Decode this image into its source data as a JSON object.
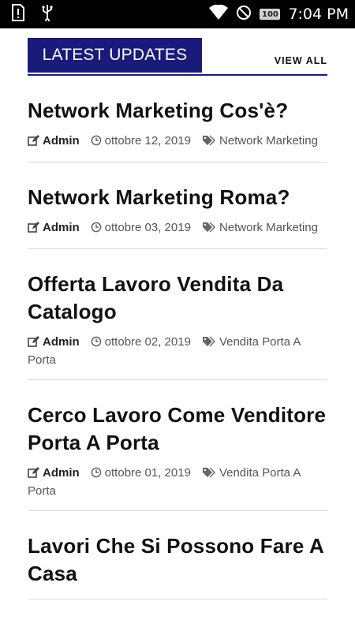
{
  "status_bar": {
    "time": "7:04 PM",
    "battery_level": "100",
    "icons": [
      "sim-alert-icon",
      "usb-icon",
      "wifi-icon",
      "do-not-disturb-icon",
      "battery-icon"
    ]
  },
  "section": {
    "title": "LATEST UPDATES",
    "view_all": "VIEW ALL",
    "accent_color": "#1a1a7a"
  },
  "posts": [
    {
      "title": "Network Marketing Cos'è?",
      "author": "Admin",
      "date": "ottobre 12, 2019",
      "category": "Network Marketing"
    },
    {
      "title": "Network Marketing Roma?",
      "author": "Admin",
      "date": "ottobre 03, 2019",
      "category": "Network Marketing"
    },
    {
      "title": "Offerta Lavoro Vendita Da Catalogo",
      "author": "Admin",
      "date": "ottobre 02, 2019",
      "category": "Vendita Porta A Porta"
    },
    {
      "title": "Cerco Lavoro Come Venditore Porta A Porta",
      "author": "Admin",
      "date": "ottobre 01, 2019",
      "category": "Vendita Porta A Porta"
    },
    {
      "title": "Lavori Che Si Possono Fare A Casa",
      "author": "",
      "date": "",
      "category": ""
    }
  ]
}
